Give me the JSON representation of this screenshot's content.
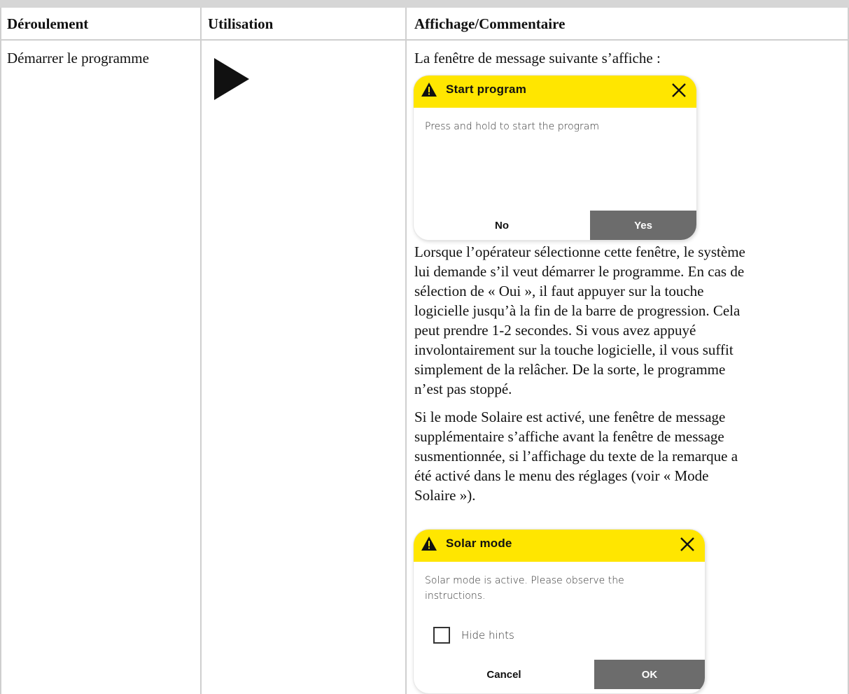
{
  "table": {
    "headers": [
      "Déroulement",
      "Utilisation",
      "Affichage/Commentaire"
    ],
    "row": {
      "step": "Démarrer le programme",
      "usage_icon": "play-icon",
      "intro": "La fenêtre de message suivante s’affiche :",
      "paragraph1_lines": [
        "Lorsque l’opérateur sélectionne cette fenêtre, le système",
        "lui demande s’il veut démarrer le programme. En cas de",
        "sélection de « Oui », il faut appuyer sur la touche",
        "logicielle jusqu’à la fin de la barre de progression. Cela",
        "peut prendre 1-2 secondes. Si vous avez appuyé",
        "involontairement sur la touche logicielle, il vous suffit",
        "simplement de la relâcher. De la sorte, le programme",
        "n’est pas stoppé."
      ],
      "paragraph2_lines": [
        "Si le mode Solaire est activé, une fenêtre de message",
        "supplémentaire s’affiche avant la fenêtre de message",
        "susmentionnée, si l’affichage du texte de la remarque a",
        "été activé dans le menu des réglages (voir « Mode",
        "Solaire »)."
      ]
    }
  },
  "dialog_start": {
    "title": "Start program",
    "message": "Press and hold to start the program",
    "no_label": "No",
    "yes_label": "Yes"
  },
  "dialog_solar": {
    "title": "Solar mode",
    "message_lines": [
      "Solar mode is active. Please observe the",
      "instructions."
    ],
    "checkbox_label": "Hide hints",
    "checkbox_checked": false,
    "cancel_label": "Cancel",
    "ok_label": "OK"
  },
  "colors": {
    "dialog_header": "#ffe600",
    "primary_button": "#6c6c6c",
    "grid_lines": "#cfcfcf"
  }
}
